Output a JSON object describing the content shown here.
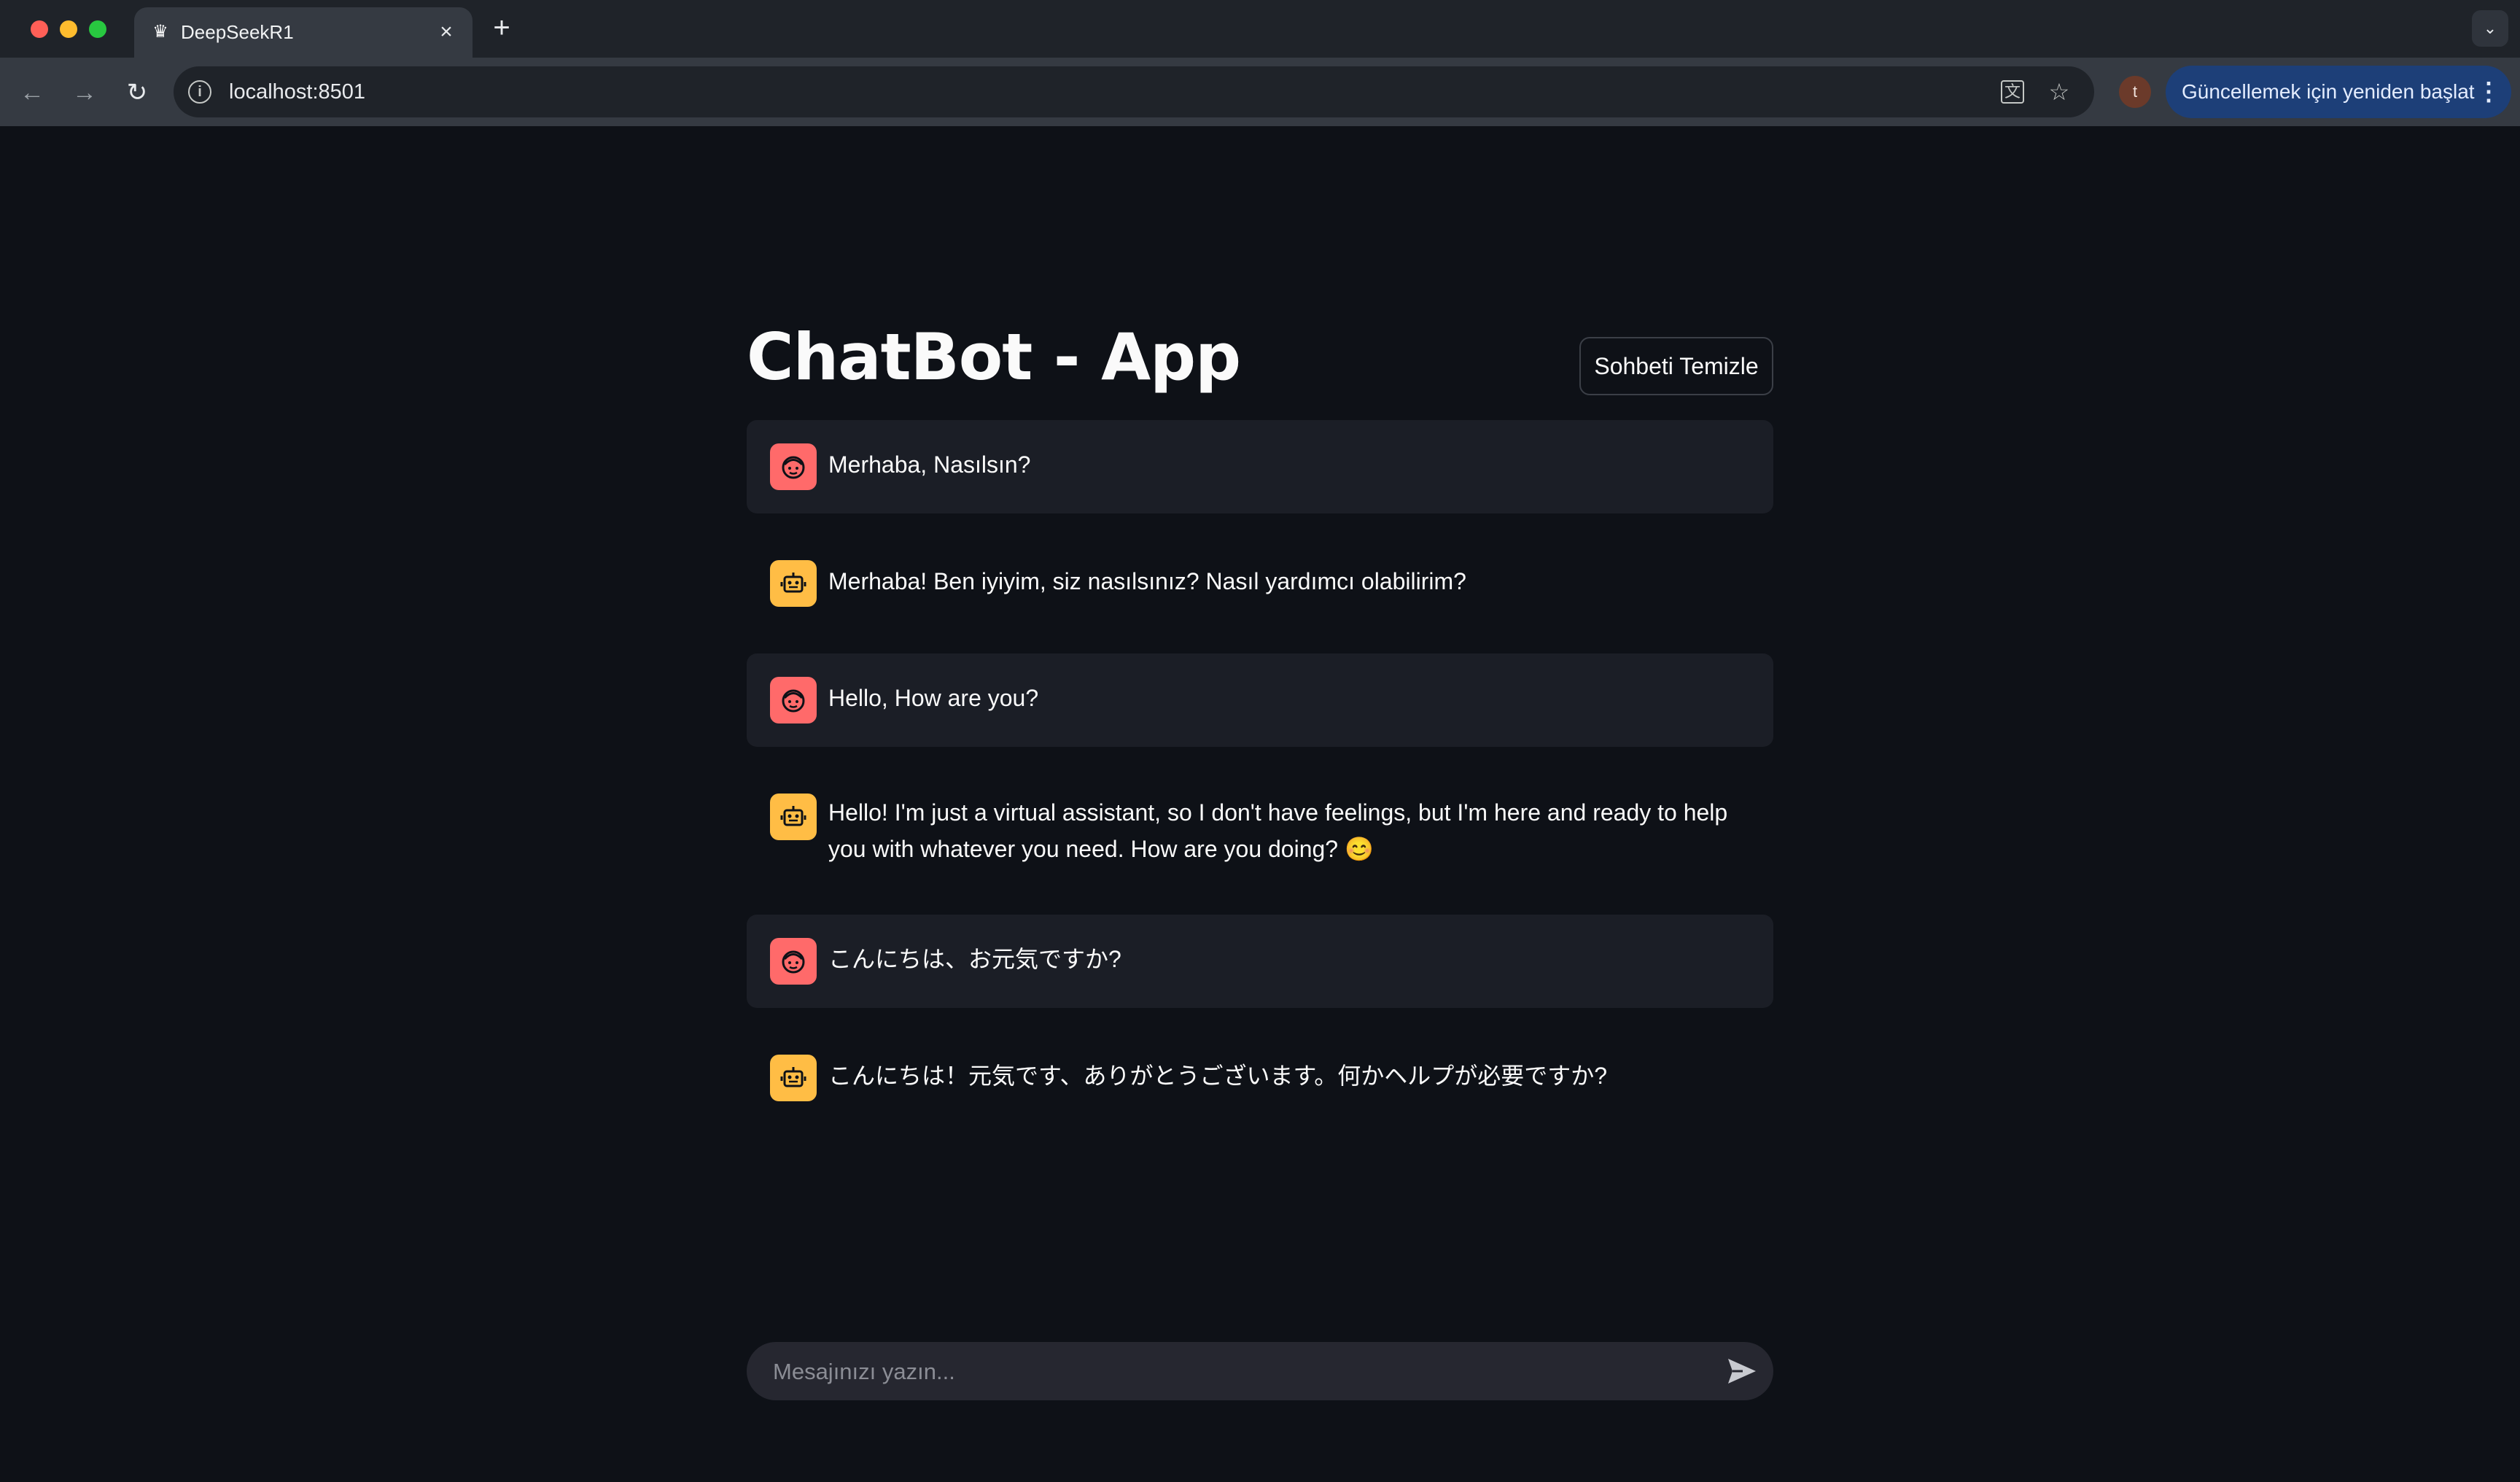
{
  "browser": {
    "tab_title": "DeepSeekR1",
    "url": "localhost:8501",
    "profile_initial": "t",
    "update_button_label": "Güncellemek için yeniden başlat",
    "icons": {
      "favicon": "crown-icon",
      "back": "back-arrow-icon",
      "forward": "forward-arrow-icon",
      "reload": "reload-icon",
      "site_info": "info-icon",
      "translate": "translate-icon",
      "bookmark": "star-icon",
      "menu": "kebab-menu-icon"
    }
  },
  "app": {
    "title": "ChatBot - App",
    "clear_button_label": "Sohbeti Temizle",
    "colors": {
      "background": "#0e1117",
      "user_avatar": "#ff6a6a",
      "bot_avatar": "#ffbd45",
      "user_bubble": "#1b1e26"
    },
    "messages": [
      {
        "role": "user",
        "text": "Merhaba, Nasılsın?"
      },
      {
        "role": "assistant",
        "text": "Merhaba! Ben iyiyim, siz nasılsınız? Nasıl yardımcı olabilirim?"
      },
      {
        "role": "user",
        "text": "Hello, How are you?"
      },
      {
        "role": "assistant",
        "text": "Hello! I'm just a virtual assistant, so I don't have feelings, but I'm here and ready to help you with whatever you need. How are you doing? 😊"
      },
      {
        "role": "user",
        "text": "こんにちは、お元気ですか?"
      },
      {
        "role": "assistant",
        "text": "こんにちは！元気です、ありがとうございます。何かヘルプが必要ですか?"
      }
    ],
    "input": {
      "value": "",
      "placeholder": "Mesajınızı yazın..."
    }
  }
}
